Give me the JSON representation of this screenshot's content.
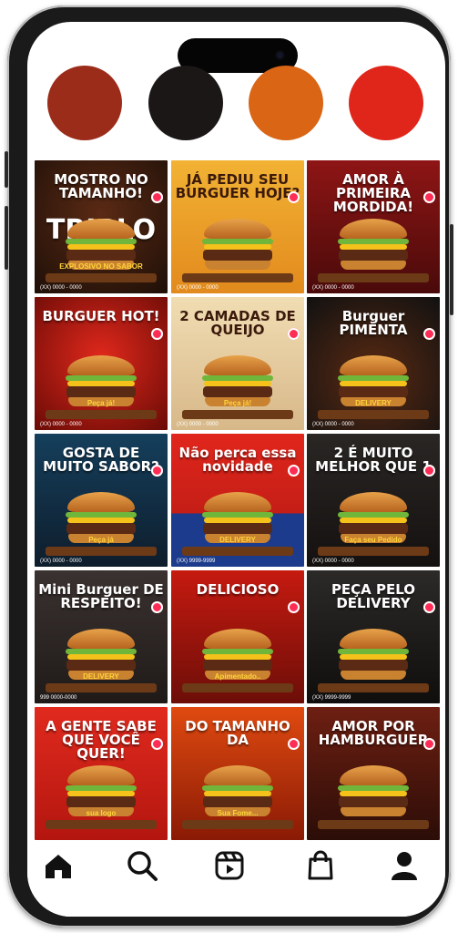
{
  "palette": [
    "#9b2c1a",
    "#1b1716",
    "#d96515",
    "#e0261a"
  ],
  "tiles": [
    {
      "headline": "MOSTRO NO TAMANHO!",
      "sub": "EXPLOSIVO NO SABOR",
      "big": "TRIPLO",
      "footer": "(XX) 0000 - 0000",
      "bg": "radial-gradient(circle at 50% 40%, #5a2a14, #1e0f08)"
    },
    {
      "headline": "JÁ PEDIU SEU BURGUER HOJE?",
      "footer": "(XX) 0000 - 0000",
      "bg": "linear-gradient(#f2b234,#e28a1d)",
      "dark": true
    },
    {
      "headline": "AMOR À PRIMEIRA MORDIDA!",
      "footer": "(XX) 0000 - 0000",
      "bg": "linear-gradient(#8e1515,#4a0a0a)"
    },
    {
      "headline": "BURGUER HOT!",
      "sub": "Peça já!",
      "footer": "(XX) 0000 - 0000",
      "bg": "radial-gradient(circle at 50% 45%, #e0281c, #6a0b06)"
    },
    {
      "headline": "2 CAMADAS DE QUEIJO",
      "sub": "Peça já!",
      "footer": "(XX) 0000 - 0000",
      "bg": "linear-gradient(#f1ddb3,#d7b889)",
      "dark": true
    },
    {
      "headline": "Burguer PIMENTA",
      "sub": "DELIVERY",
      "footer": "(XX) 0000 - 0000",
      "bg": "radial-gradient(circle at 50% 60%, #5b2a12, #111)"
    },
    {
      "headline": "GOSTA DE MUITO SABOR?",
      "sub": "Peça já",
      "footer": "(XX) 0000 - 0000",
      "bg": "linear-gradient(#153f5c,#0e1d2c)"
    },
    {
      "headline": "Não perca essa novidade",
      "sub": "DELIVERY",
      "footer": "(XX) 9999-9999",
      "bg": "linear-gradient(#e1261c,#c41e16 60%, #1d3b8c 60%)"
    },
    {
      "headline": "2 É MUITO MELHOR QUE 1",
      "sub": "Faça seu Pedido",
      "footer": "(XX) 0000 - 0000",
      "bg": "linear-gradient(#2a2624,#141110)"
    },
    {
      "headline": "Mini Burguer DE RESPEITO!",
      "sub": "DELIVERY",
      "footer": "999 0000-0000",
      "bg": "linear-gradient(#3a3230,#1f1a18)"
    },
    {
      "headline": "DELICIOSO",
      "sub": "Apimentado..",
      "bg": "linear-gradient(#c61a10,#6c0e08)"
    },
    {
      "headline": "PEÇA PELO DELIVERY",
      "footer": "(XX) 9999-9999",
      "bg": "linear-gradient(#2c2a28,#0f0e0d)"
    },
    {
      "headline": "A GENTE SABE QUE VOCÊ QUER!",
      "sub": "sua logo",
      "bg": "linear-gradient(#e12a1e,#b3160f)"
    },
    {
      "headline": "DO TAMANHO DA",
      "sub": "Sua Fome...",
      "bg": "linear-gradient(#e04a10,#8a1a05)"
    },
    {
      "headline": "AMOR POR HAMBURGUER",
      "bg": "linear-gradient(#6e1f12,#2b0d07)"
    }
  ],
  "tabbar": {
    "icons": [
      "home-icon",
      "search-icon",
      "reels-icon",
      "shop-icon",
      "profile-icon"
    ]
  }
}
